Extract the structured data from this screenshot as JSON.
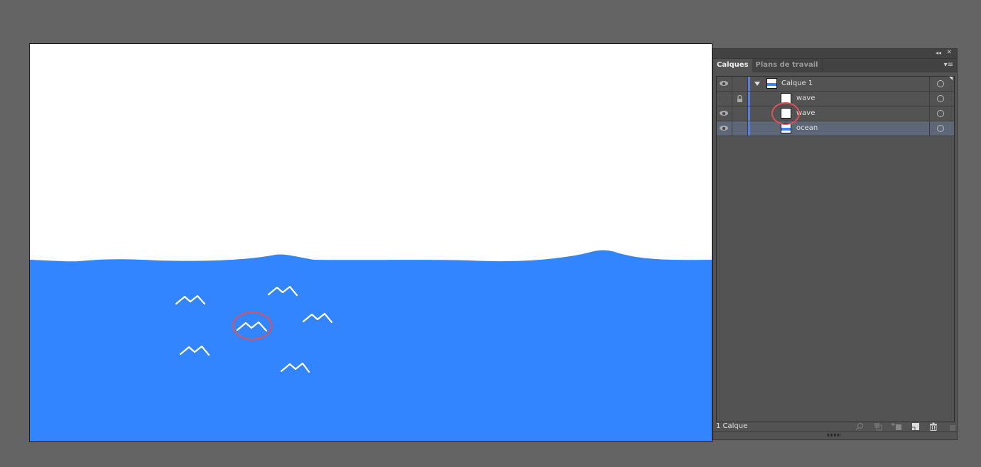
{
  "artboard": {
    "background": "#ffffff",
    "ocean_color": "#3385ff",
    "wave_stroke_color": "#ffffff",
    "highlight_color": "#e05059"
  },
  "panel": {
    "top_bar": {
      "collapse_icon": "double-chevron-left-icon",
      "close_icon": "close-icon",
      "collapse_glyph": "◂◂",
      "close_glyph": "✕"
    },
    "tabs": [
      {
        "label": "Calques",
        "active": true
      },
      {
        "label": "Plans de travail",
        "active": false
      }
    ],
    "menu_glyph": "▾≡",
    "layers": [
      {
        "name": "Calque 1",
        "visible": true,
        "locked": false,
        "expanded": true,
        "thumbnail": "ocean",
        "level": 0
      },
      {
        "name": "wave",
        "visible": false,
        "locked": true,
        "thumbnail": "white",
        "level": 1
      },
      {
        "name": "wave",
        "visible": true,
        "locked": false,
        "thumbnail": "white",
        "level": 1,
        "highlighted": true
      },
      {
        "name": "ocean",
        "visible": true,
        "locked": false,
        "thumbnail": "ocean",
        "level": 1,
        "selected": true
      }
    ],
    "layer_color": "#4f7ff4",
    "footer": {
      "count_label": "1 Calque",
      "icons": [
        "locate-object-icon",
        "make-clipping-mask-icon",
        "create-sublayer-icon",
        "new-layer-icon",
        "trash-icon"
      ]
    }
  }
}
